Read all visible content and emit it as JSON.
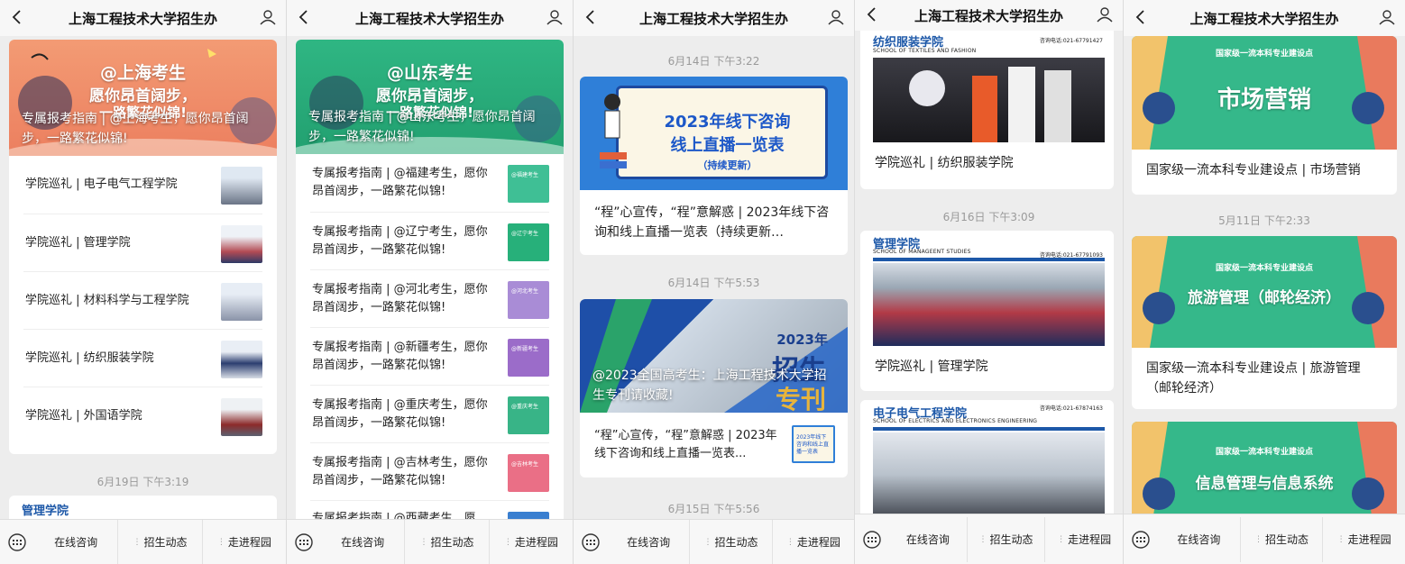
{
  "app": {
    "title": "上海工程技术大学招生办"
  },
  "bottom_menu": [
    "在线咨询",
    "招生动态",
    "走进程园"
  ],
  "panel1": {
    "banner_line1": "@上海考生",
    "banner_line2": "愿你昂首阔步，",
    "banner_line3": "一路繁花似锦!",
    "banner_title": "专属报考指南 | @上海考生，愿你昂首阔步，一路繁花似锦!",
    "rows": [
      "学院巡礼 | 电子电气工程学院",
      "学院巡礼 | 管理学院",
      "学院巡礼 | 材料科学与工程学院",
      "学院巡礼 | 纺织服装学院",
      "学院巡礼 | 外国语学院"
    ],
    "timestamp": "6月19日 下午3:19",
    "next_peek": "管理学院"
  },
  "panel2": {
    "banner_line1": "@山东考生",
    "banner_line2": "愿你昂首阔步，",
    "banner_line3": "一路繁花似锦!",
    "banner_title": "专属报考指南 | @山东考生，愿你昂首阔步，一路繁花似锦!",
    "rows": [
      "专属报考指南 | @福建考生，愿你昂首阔步，一路繁花似锦!",
      "专属报考指南 | @辽宁考生，愿你昂首阔步，一路繁花似锦!",
      "专属报考指南 | @河北考生，愿你昂首阔步，一路繁花似锦!",
      "专属报考指南 | @新疆考生，愿你昂首阔步，一路繁花似锦!",
      "专属报考指南 | @重庆考生，愿你昂首阔步，一路繁花似锦!",
      "专属报考指南 | @吉林考生，愿你昂首阔步，一路繁花似锦!"
    ],
    "cut_row": "专属报考指南 | @西藏考生，愿",
    "thumb_labels": [
      "@福建考生",
      "@辽宁考生",
      "@河北考生",
      "@新疆考生",
      "@重庆考生",
      "@吉林考生"
    ]
  },
  "panel3": {
    "ts1": "6月14日 下午3:22",
    "card1_banner_line1": "2023年线下咨询",
    "card1_banner_line2": "线上直播一览表",
    "card1_banner_line3": "（持续更新）",
    "card1_caption": "“程”心宣传，“程”意解惑 | 2023年线下咨询和线上直播一览表（持续更新…",
    "ts2": "6月14日 下午5:53",
    "card2_banner_year": "2023年",
    "card2_banner_big": "招生",
    "card2_banner_big2": "专刊",
    "card2_banner_title": "@2023全国高考生：上海工程技术大学招生专刊请收藏!",
    "card2_row": "“程”心宣传，“程”意解惑 | 2023年线下咨询和线上直播一览表...",
    "card2_thumb": "2023年线下咨询和线上直播一览表",
    "ts3": "6月15日 下午5:56"
  },
  "panel4": {
    "card1_school": "纺织服装学院",
    "card1_school_en": "SCHOOL OF TEXTILES AND FASHION",
    "card1_phone": "咨询电话:021-67791427",
    "card1_caption": "学院巡礼 | 纺织服装学院",
    "ts1": "6月16日 下午3:09",
    "card2_school": "管理学院",
    "card2_school_en": "SCHOOL OF MANAGEENT STUDIES",
    "card2_phone": "咨询电话:021-67791093",
    "card2_caption": "学院巡礼 | 管理学院",
    "card3_school": "电子电气工程学院",
    "card3_school_en": "SCHOOL OF ELECTRICS AND ELECTRONICS ENGINEERING",
    "card3_phone": "咨询电话:021-67874163"
  },
  "panel5": {
    "card1_label": "国家级一流本科专业建设点",
    "card1_big": "市场营销",
    "card1_caption": "国家级一流本科专业建设点 | 市场营销",
    "ts1": "5月11日 下午2:33",
    "card2_label": "国家级一流本科专业建设点",
    "card2_big": "旅游管理（邮轮经济）",
    "card2_caption": "国家级一流本科专业建设点 | 旅游管理（邮轮经济）",
    "card3_label": "国家级一流本科专业建设点",
    "card3_big": "信息管理与信息系统"
  },
  "colors": {
    "accent_green": "#2fb07a",
    "orange_banner": "#f08a64",
    "blue": "#1d58a8",
    "ui_bg": "#ededed"
  }
}
